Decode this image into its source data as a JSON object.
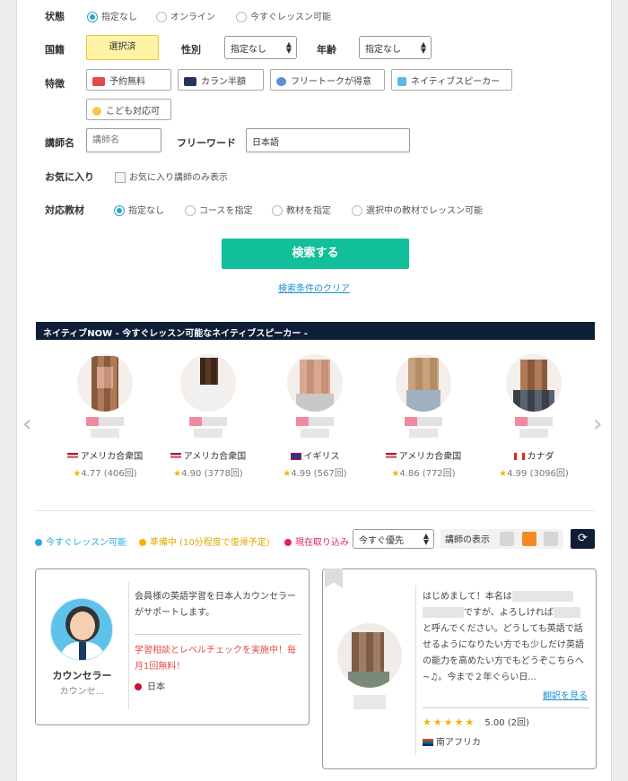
{
  "filters": {
    "status": {
      "label": "状態",
      "options": [
        "指定なし",
        "オンライン",
        "今すぐレッスン可能"
      ]
    },
    "nationality": {
      "label": "国籍",
      "value": "選択済"
    },
    "gender": {
      "label": "性別",
      "value": "指定なし"
    },
    "age": {
      "label": "年齢",
      "value": "指定なし"
    },
    "features": {
      "label": "特徴",
      "items": [
        "予約無料",
        "カラン半額",
        "フリートークが得意",
        "ネイティブスピーカー",
        "こども対応可"
      ]
    },
    "teacher_name": {
      "label": "講師名",
      "placeholder": "講師名"
    },
    "free_word": {
      "label": "フリーワード",
      "value": "日本語"
    },
    "favorites": {
      "label": "お気に入り",
      "option": "お気に入り講師のみ表示"
    },
    "material": {
      "label": "対応教材",
      "options": [
        "指定なし",
        "コースを指定",
        "教材を指定",
        "選択中の教材でレッスン可能"
      ]
    },
    "search_button": "検索する",
    "clear_link": "検索条件のクリア"
  },
  "native_now": {
    "title": "ネイティブNOW - 今すぐレッスン可能なネイティブスピーカー -",
    "teachers": [
      {
        "country": "アメリカ合衆国",
        "rating": "4.77 (406回)"
      },
      {
        "country": "アメリカ合衆国",
        "rating": "4.90 (3778回)"
      },
      {
        "country": "イギリス",
        "rating": "4.99 (567回)"
      },
      {
        "country": "アメリカ合衆国",
        "rating": "4.86 (772回)"
      },
      {
        "country": "カナダ",
        "rating": "4.99 (3096回)"
      }
    ]
  },
  "legend": {
    "available": "今すぐレッスン可能",
    "preparing": "準備中 (10分程度で復帰予定)",
    "busy": "現在取り込み",
    "sort": "今すぐ優先",
    "display_label": "講師の表示"
  },
  "cards": {
    "counselor": {
      "name": "カウンセラー",
      "subtitle": "カウンセ…",
      "description": "会員様の英語学習を日本人カウンセラーがサポートします。",
      "promo": "学習相談とレベルチェックを実施中！毎月1回無料！",
      "country": "日本"
    },
    "teacher": {
      "intro_1": "はじめまして！本名は",
      "intro_2": "ですが、よろしければ",
      "intro_3": "と呼んでください。どうしても英語で話せるようになりたい方でも少しだけ英語の能力を高めたい方でもどうぞこちらへ~♫。今まで２年ぐらい日...",
      "translate": "翻訳を見る",
      "score": "5.00 (2回)",
      "country": "南アフリカ"
    }
  },
  "colors": {
    "accent": "#11bf9a",
    "link": "#1e8fd0",
    "band": "#0d1e36",
    "available": "#29a9e0",
    "preparing": "#f5b400",
    "busy": "#e0245e"
  }
}
